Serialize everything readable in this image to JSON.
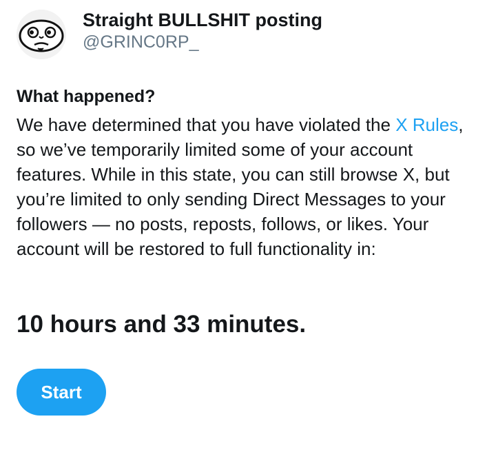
{
  "profile": {
    "display_name": "Straight BULLSHIT posting",
    "handle": "@GRINC0RP_",
    "avatar_icon": "face-avatar-icon"
  },
  "notice": {
    "title": "What happened?",
    "text_before_link": "We have determined that you have violated the ",
    "link_text": "X Rules",
    "text_after_link": ", so we’ve temporarily limited some of your account features. While in this state, you can still browse X, but you’re limited to only sending Direct Messages to your followers — no posts, reposts, follows, or likes. Your account will be restored to full functionality in:",
    "countdown": "10 hours and 33 minutes."
  },
  "actions": {
    "start_label": "Start"
  },
  "colors": {
    "accent": "#1da1f2",
    "text": "#14171a",
    "secondary_text": "#657786"
  }
}
